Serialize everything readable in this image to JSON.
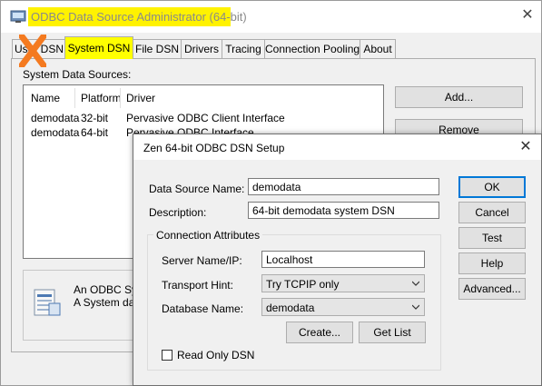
{
  "window": {
    "title": "ODBC Data Source Administrator (64-bit)",
    "close_symbol": "✕"
  },
  "tabs": [
    {
      "label": "User DSN",
      "active": false
    },
    {
      "label": "System DSN",
      "active": true
    },
    {
      "label": "File DSN",
      "active": false
    },
    {
      "label": "Drivers",
      "active": false
    },
    {
      "label": "Tracing",
      "active": false
    },
    {
      "label": "Connection Pooling",
      "active": false
    },
    {
      "label": "About",
      "active": false
    }
  ],
  "system_dsn": {
    "section_label": "System Data Sources:",
    "columns": [
      "Name",
      "Platform",
      "Driver"
    ],
    "rows": [
      {
        "name": "demodata",
        "platform": "32-bit",
        "driver": "Pervasive ODBC Client Interface"
      },
      {
        "name": "demodata",
        "platform": "64-bit",
        "driver": "Pervasive ODBC Interface"
      }
    ],
    "buttons": {
      "add": "Add...",
      "remove": "Remove"
    },
    "info": {
      "line1": "An ODBC Syst",
      "line2": "A System data"
    }
  },
  "setup_dialog": {
    "title": "Zen 64-bit ODBC DSN Setup",
    "close_symbol": "✕",
    "data_source_name_label": "Data Source Name:",
    "data_source_name_value": "demodata",
    "description_label": "Description:",
    "description_value": "64-bit demodata system DSN",
    "group_title": "Connection Attributes",
    "server_label": "Server Name/IP:",
    "server_value": "Localhost",
    "transport_label": "Transport Hint:",
    "transport_value": "Try TCPIP only",
    "database_label": "Database Name:",
    "database_value": "demodata",
    "create_button": "Create...",
    "get_list_button": "Get List",
    "read_only_label": "Read Only DSN",
    "read_only_checked": false,
    "buttons": {
      "ok": "OK",
      "cancel": "Cancel",
      "test": "Test",
      "help": "Help",
      "advanced": "Advanced..."
    }
  },
  "colors": {
    "highlight": "#ffff00",
    "annotation_x": "#f47a20",
    "focus_border": "#0078d7"
  },
  "icons": [
    "app-icon",
    "close-icon",
    "odbc-info-icon",
    "chevron-down-icon",
    "annotation-x-mark"
  ]
}
